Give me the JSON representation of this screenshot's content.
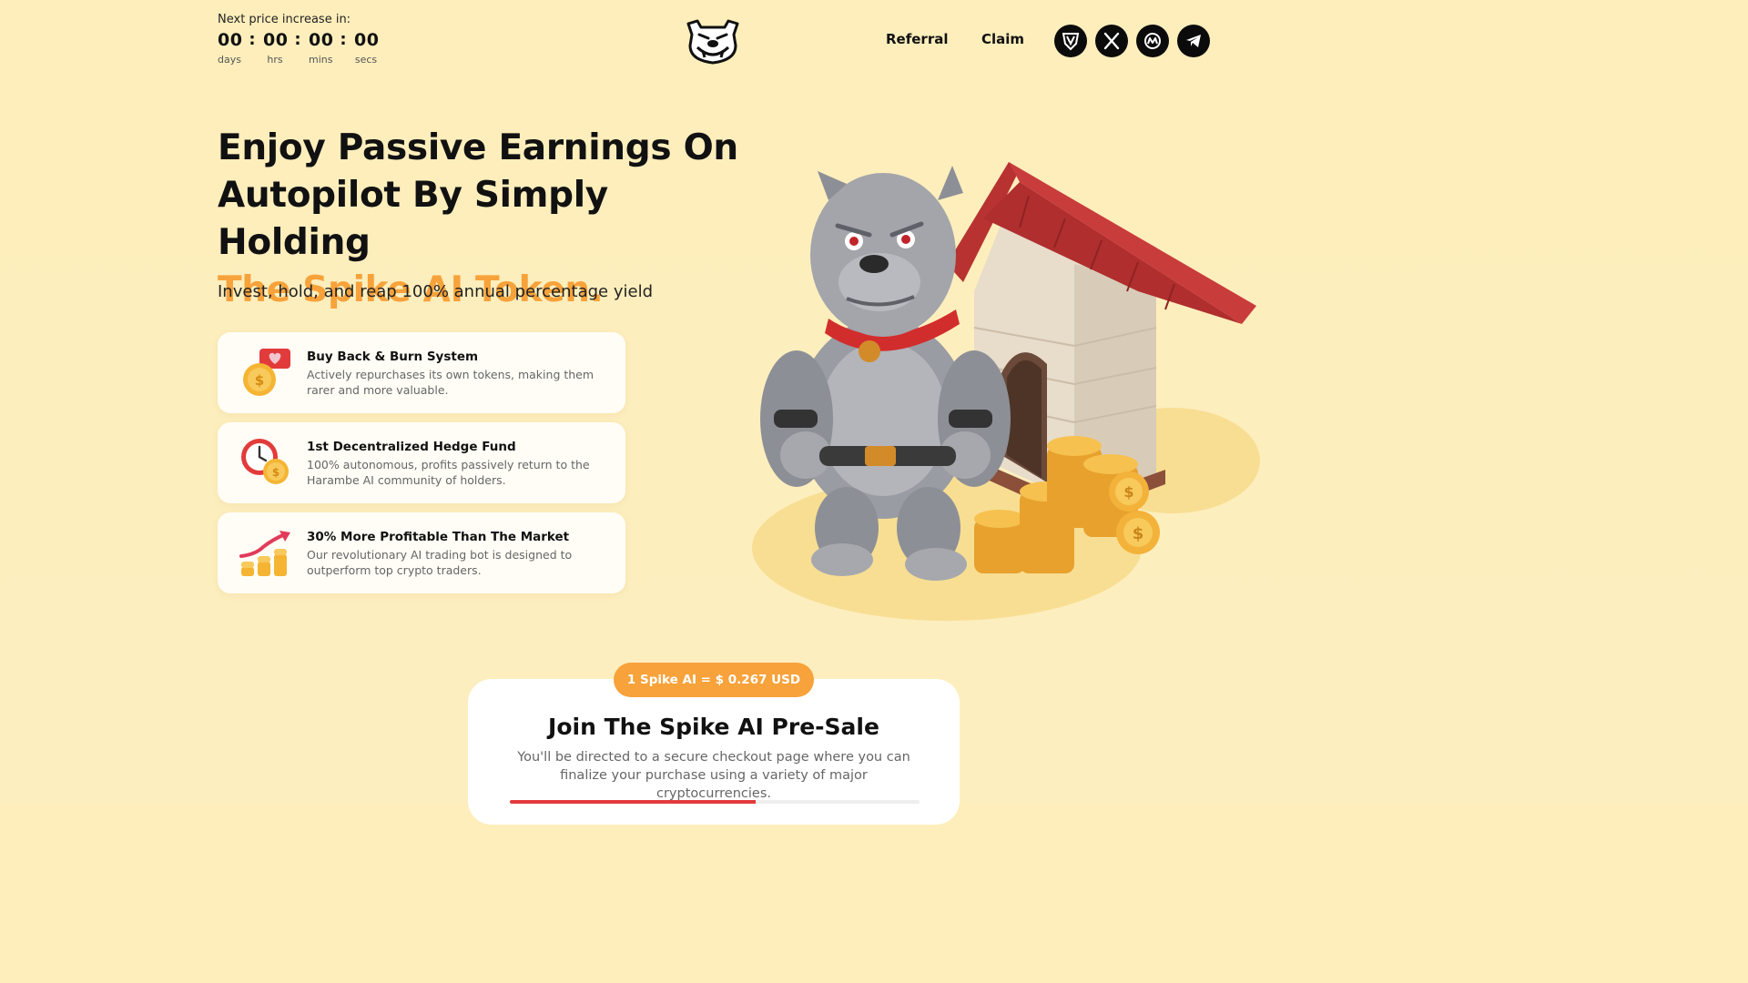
{
  "header": {
    "countdown_label": "Next price increase in:",
    "countdown": [
      {
        "value": "00",
        "unit": "days"
      },
      {
        "value": "00",
        "unit": "hrs"
      },
      {
        "value": "00",
        "unit": "mins"
      },
      {
        "value": "00",
        "unit": "secs"
      }
    ],
    "separator": ":",
    "nav": {
      "referral": "Referral",
      "claim": "Claim"
    },
    "socials": [
      "shield-logo-icon",
      "x-icon",
      "coinmarketcap-icon",
      "telegram-icon"
    ]
  },
  "hero": {
    "title_line1": "Enjoy Passive Earnings On",
    "title_line2": "Autopilot By Simply Holding",
    "title_accent": "The Spike AI Token.",
    "subtitle": "Invest, hold, and reap 100% annual percentage yield"
  },
  "features": [
    {
      "icon": "coin-heart-icon",
      "title": "Buy Back & Burn System",
      "desc": "Actively repurchases its own tokens, making them rarer and more valuable."
    },
    {
      "icon": "clock-coin-icon",
      "title": "1st Decentralized Hedge Fund",
      "desc": "100% autonomous, profits passively return to the Harambe AI community of holders."
    },
    {
      "icon": "growth-chart-icon",
      "title": "30% More Profitable Than The Market",
      "desc": "Our revolutionary AI trading bot is designed to outperform top crypto traders."
    }
  ],
  "presale": {
    "price": "1 Spike AI = $ 0.267 USD",
    "title": "Join The Spike AI Pre-Sale",
    "desc": "You'll be directed to a secure checkout page where you can finalize your purchase using a variety of major cryptocurrencies.",
    "progress": 0.6
  },
  "colors": {
    "accent": "#f7a23a",
    "background": "#fdeebb",
    "progress": "#e23b3b"
  }
}
